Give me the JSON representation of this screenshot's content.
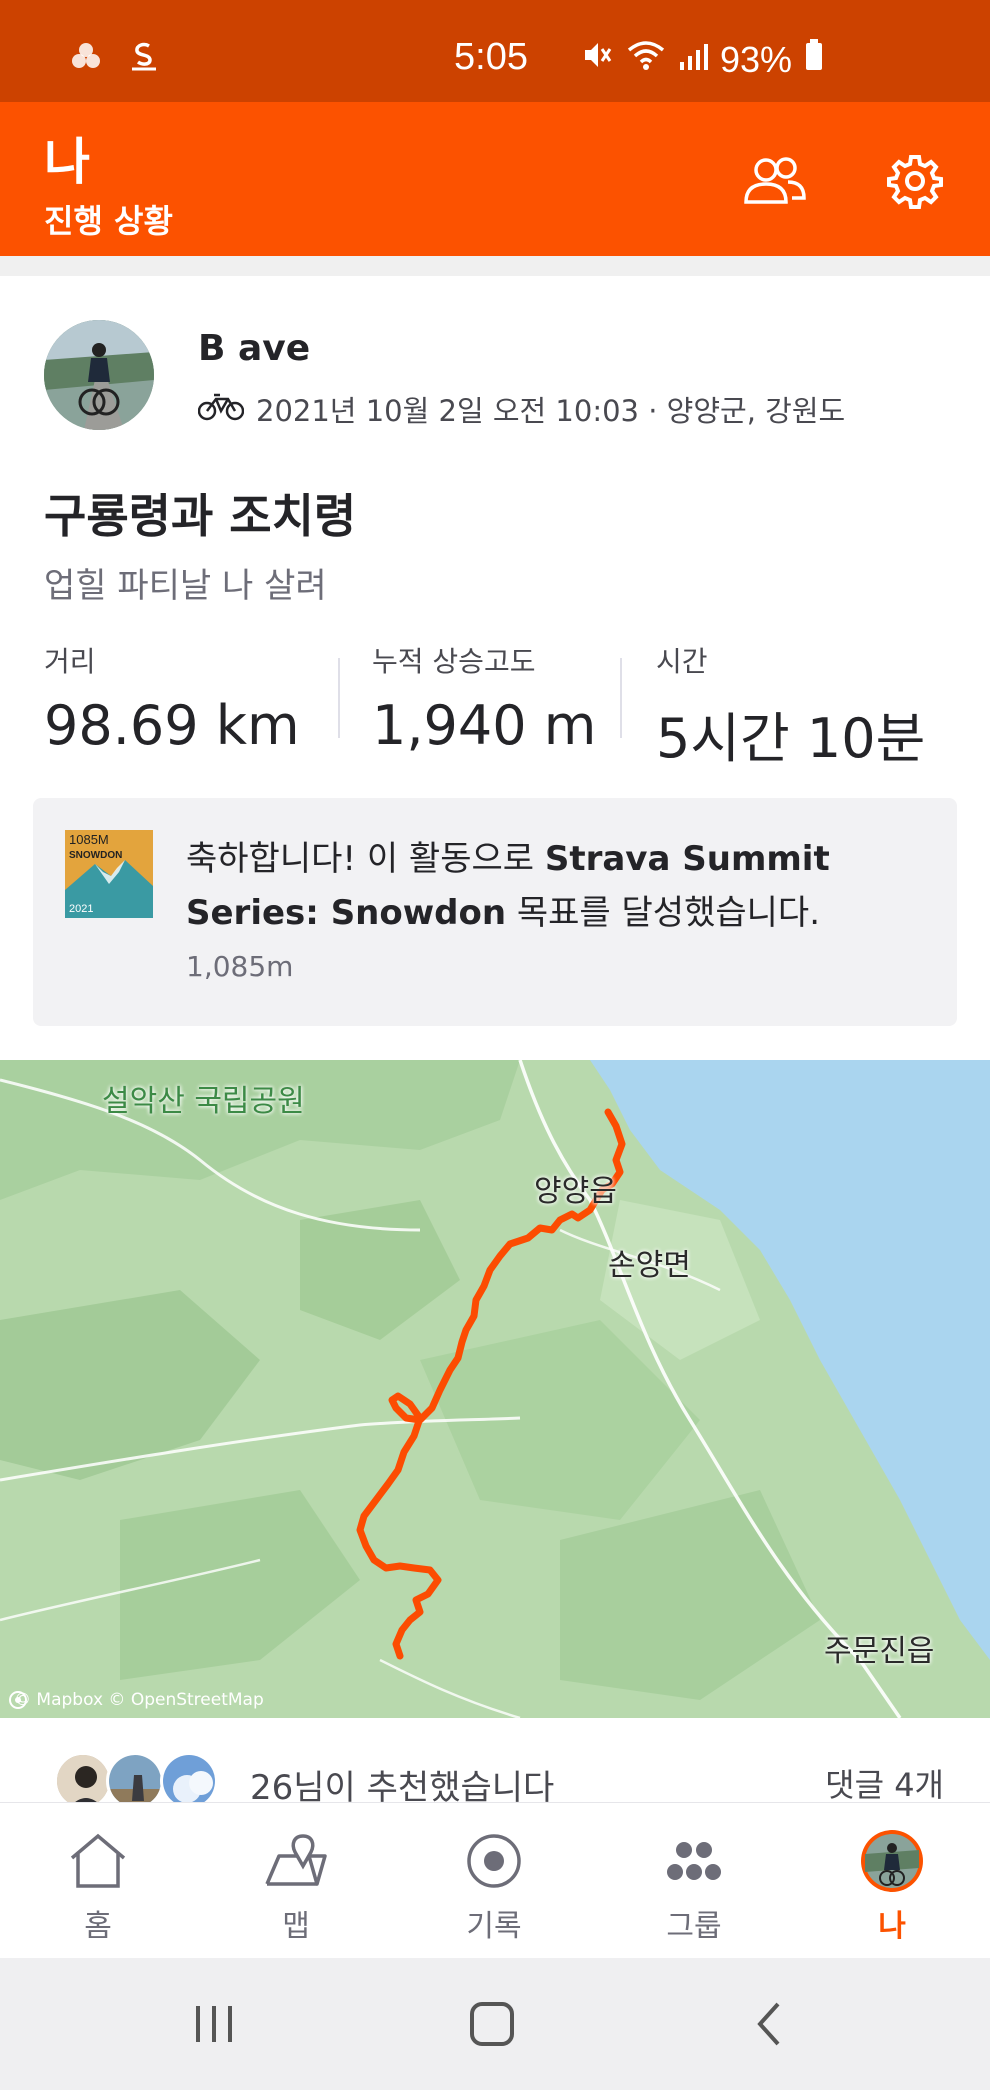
{
  "status_bar": {
    "time": "5:05",
    "battery": "93%",
    "icons": [
      "notification-dots-icon",
      "strava-logo-icon",
      "mute-icon",
      "wifi-icon",
      "signal-icon",
      "battery-icon"
    ]
  },
  "header": {
    "title": "나",
    "subtitle": "진행 상황",
    "friends_icon": "friends-icon",
    "settings_icon": "gear-icon"
  },
  "activity": {
    "athlete_name": "B ave",
    "sport_icon": "bike-icon",
    "meta": "2021년 10월 2일 오전 10:03 · 양양군, 강원도",
    "title": "구룡령과 조치령",
    "description": "업힐 파티날 나 살려",
    "stats": [
      {
        "label": "거리",
        "value": "98.69 km"
      },
      {
        "label": "누적 상승고도",
        "value": "1,940 m"
      },
      {
        "label": "시간",
        "value": "5시간 10분"
      }
    ]
  },
  "achievement": {
    "badge": {
      "top": "1085M",
      "name": "SNOWDON",
      "year": "2021"
    },
    "text_prefix": "축하합니다! 이 활동으로 ",
    "text_bold": "Strava Summit Series: Snowdon",
    "text_suffix": " 목표를 달성했습니다.",
    "subtext": "1,085m"
  },
  "map": {
    "labels": {
      "park": "설악산 국립공원",
      "town1": "양양읍",
      "town2": "손양면",
      "town3": "주문진읍"
    },
    "attribution": "© Mapbox © OpenStreetMap",
    "route_color": "#fc4c02",
    "land_color": "#b9dbb0",
    "sea_color": "#aad5ef"
  },
  "social": {
    "kudos": "26님이 추천했습니다",
    "comments": "댓글 4개"
  },
  "bottom_nav": [
    {
      "label": "홈",
      "icon": "home-icon"
    },
    {
      "label": "맵",
      "icon": "map-icon"
    },
    {
      "label": "기록",
      "icon": "record-icon"
    },
    {
      "label": "그룹",
      "icon": "groups-icon"
    },
    {
      "label": "나",
      "icon": "profile-avatar-icon",
      "active": true
    }
  ],
  "accent_color": "#fc5200"
}
